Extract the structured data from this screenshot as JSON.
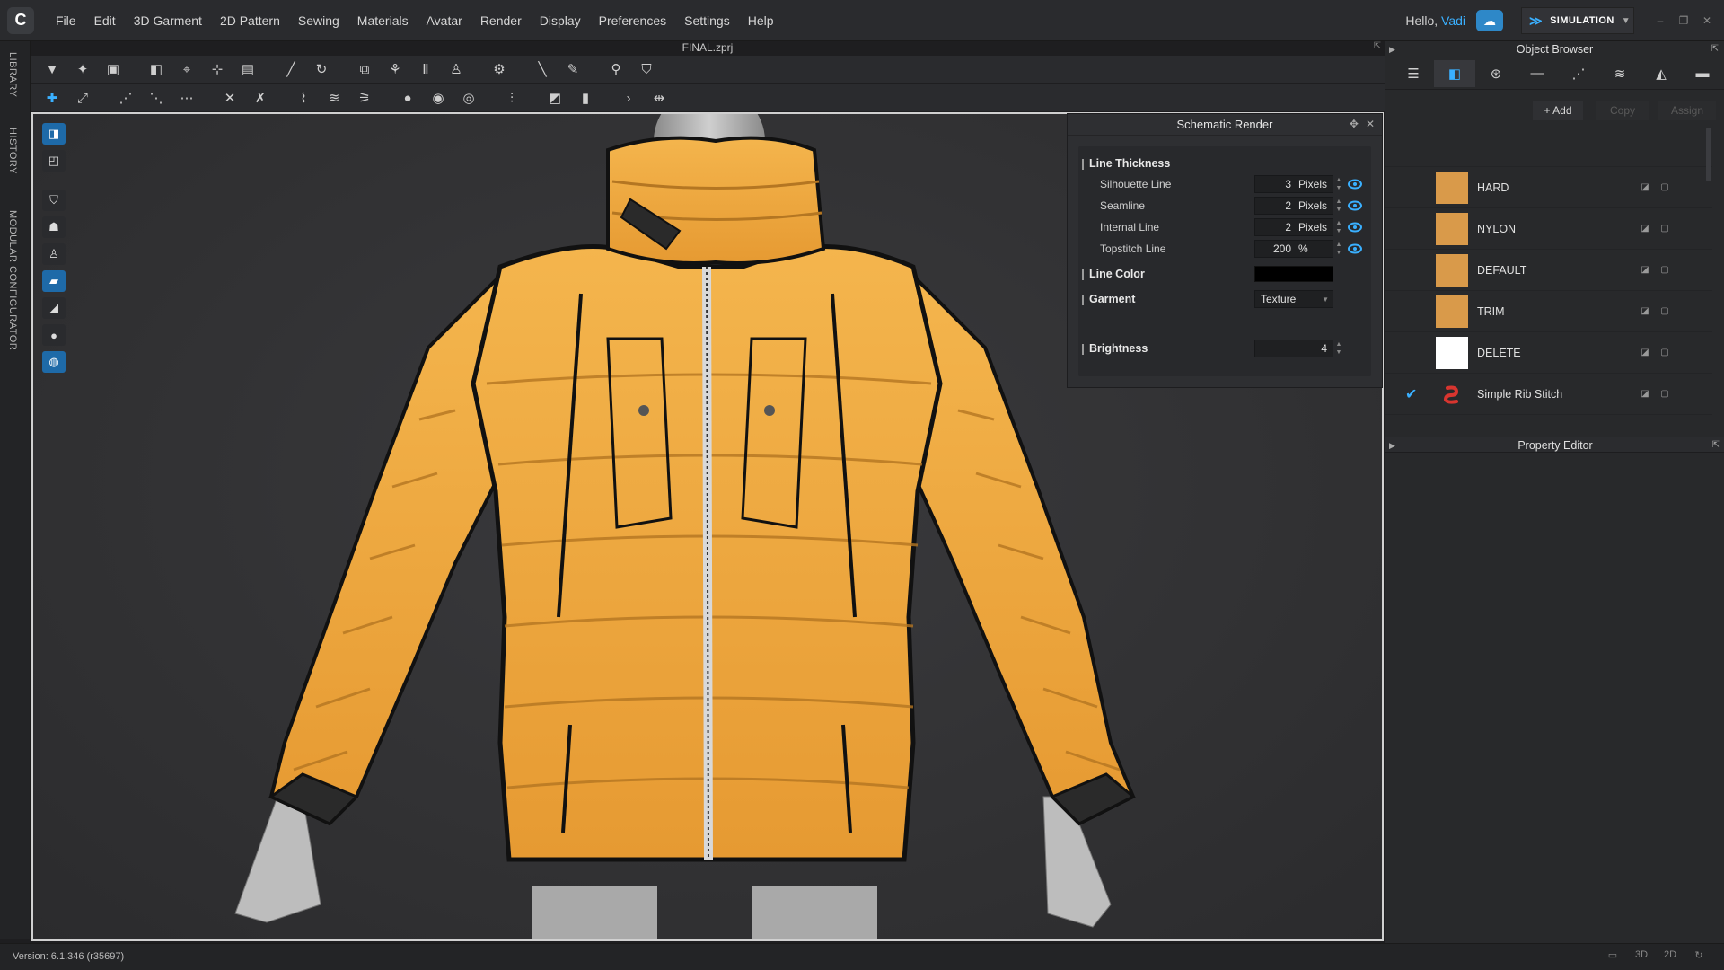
{
  "app": {
    "logo": "C",
    "menu": [
      "File",
      "Edit",
      "3D Garment",
      "2D Pattern",
      "Sewing",
      "Materials",
      "Avatar",
      "Render",
      "Display",
      "Preferences",
      "Settings",
      "Help"
    ],
    "hello_prefix": "Hello, ",
    "user_name": "Vadi",
    "mode_label": "SIMULATION"
  },
  "left_tabs": [
    "LIBRARY",
    "HISTORY",
    "MODULAR CONFIGURATOR"
  ],
  "viewport": {
    "file_name": "FINAL.zprj"
  },
  "schematic": {
    "title": "Schematic Render",
    "line_thickness_label": "Line Thickness",
    "rows": [
      {
        "label": "Silhouette Line",
        "value": "3",
        "unit": "Pixels"
      },
      {
        "label": "Seamline",
        "value": "2",
        "unit": "Pixels"
      },
      {
        "label": "Internal Line",
        "value": "2",
        "unit": "Pixels"
      },
      {
        "label": "Topstitch Line",
        "value": "200",
        "unit": "%"
      }
    ],
    "line_color_label": "Line Color",
    "line_color": "#000000",
    "garment_label": "Garment",
    "garment_value": "Texture",
    "brightness_label": "Brightness",
    "brightness_value": "4"
  },
  "object_browser": {
    "title": "Object Browser",
    "add_label": "+ Add",
    "copy_label": "Copy",
    "assign_label": "Assign",
    "materials": [
      {
        "name": "HARD",
        "color": "#d99a4a",
        "checked": false
      },
      {
        "name": "NYLON",
        "color": "#d99a4a",
        "checked": false
      },
      {
        "name": "DEFAULT",
        "color": "#d99a4a",
        "checked": false
      },
      {
        "name": "TRIM",
        "color": "#d99a4a",
        "checked": false
      },
      {
        "name": "DELETE",
        "color": "#ffffff",
        "checked": false
      },
      {
        "name": "Simple Rib Stitch",
        "color": "#d8352f",
        "checked": true
      }
    ]
  },
  "property_editor": {
    "title": "Property Editor"
  },
  "status": {
    "version": "Version: 6.1.346 (r35697)"
  },
  "colors": {
    "accent": "#3ab0ff",
    "jacket": "#f0a93f",
    "panel_bg": "#2e2f32"
  }
}
